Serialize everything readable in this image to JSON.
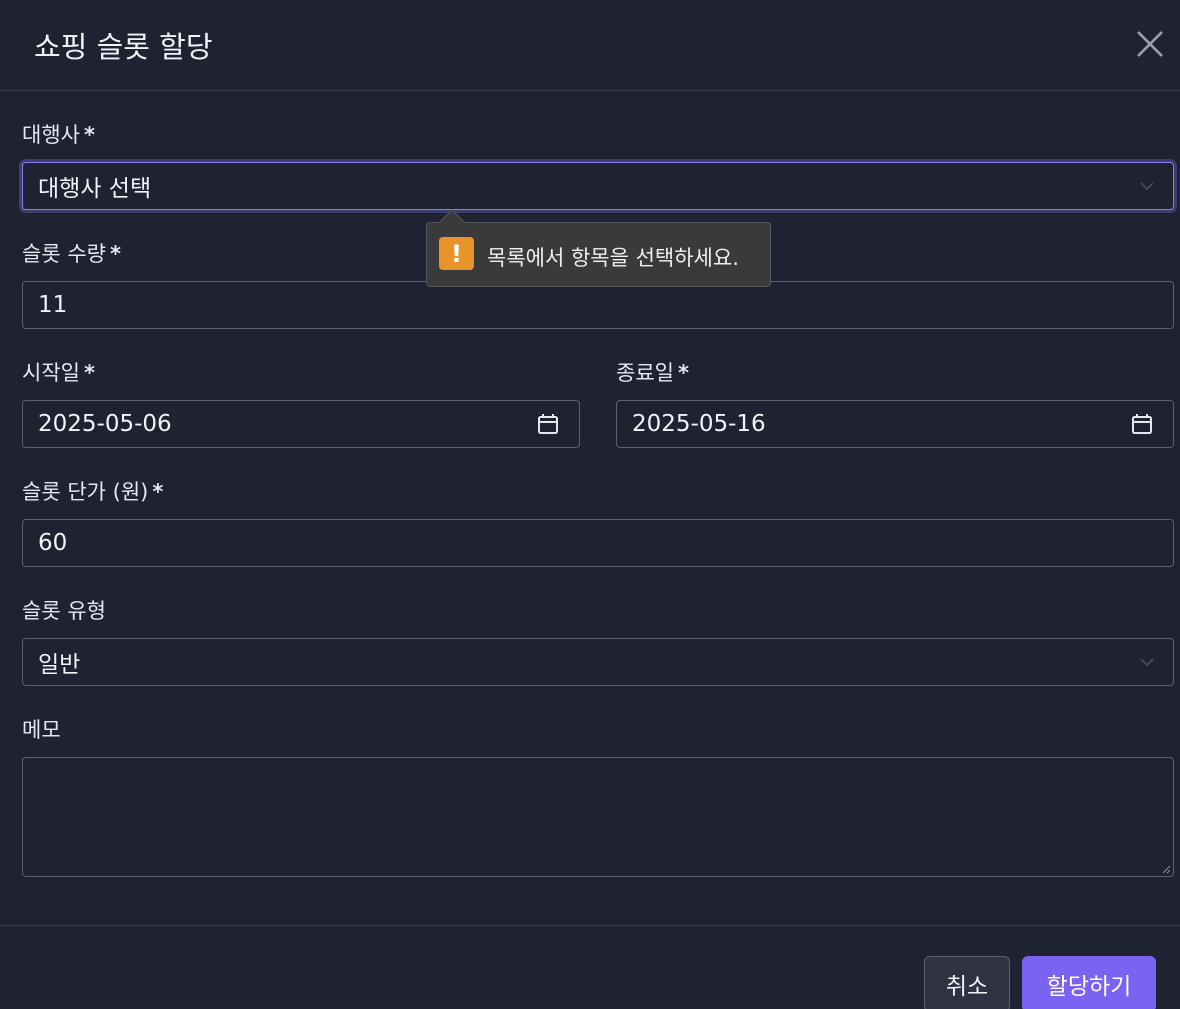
{
  "modal": {
    "title": "쇼핑 슬롯 할당"
  },
  "form": {
    "agency": {
      "label": "대행사",
      "required": "*",
      "value": "대행사 선택"
    },
    "slot_count": {
      "label": "슬롯 수량",
      "required": "*",
      "value": "11"
    },
    "start_date": {
      "label": "시작일",
      "required": "*",
      "value": "2025-05-06"
    },
    "end_date": {
      "label": "종료일",
      "required": "*",
      "value": "2025-05-16"
    },
    "unit_price": {
      "label": "슬롯 단가 (원)",
      "required": "*",
      "value": "60"
    },
    "slot_type": {
      "label": "슬롯 유형",
      "value": "일반"
    },
    "memo": {
      "label": "메모",
      "value": ""
    }
  },
  "validation_tooltip": {
    "message": "목록에서 항목을 선택하세요.",
    "icon": "warning-icon",
    "icon_color": "#e8942b"
  },
  "buttons": {
    "cancel": "취소",
    "submit": "할당하기"
  },
  "colors": {
    "background": "#1f2231",
    "accent": "#7a63f2",
    "border": "#5c6072"
  }
}
